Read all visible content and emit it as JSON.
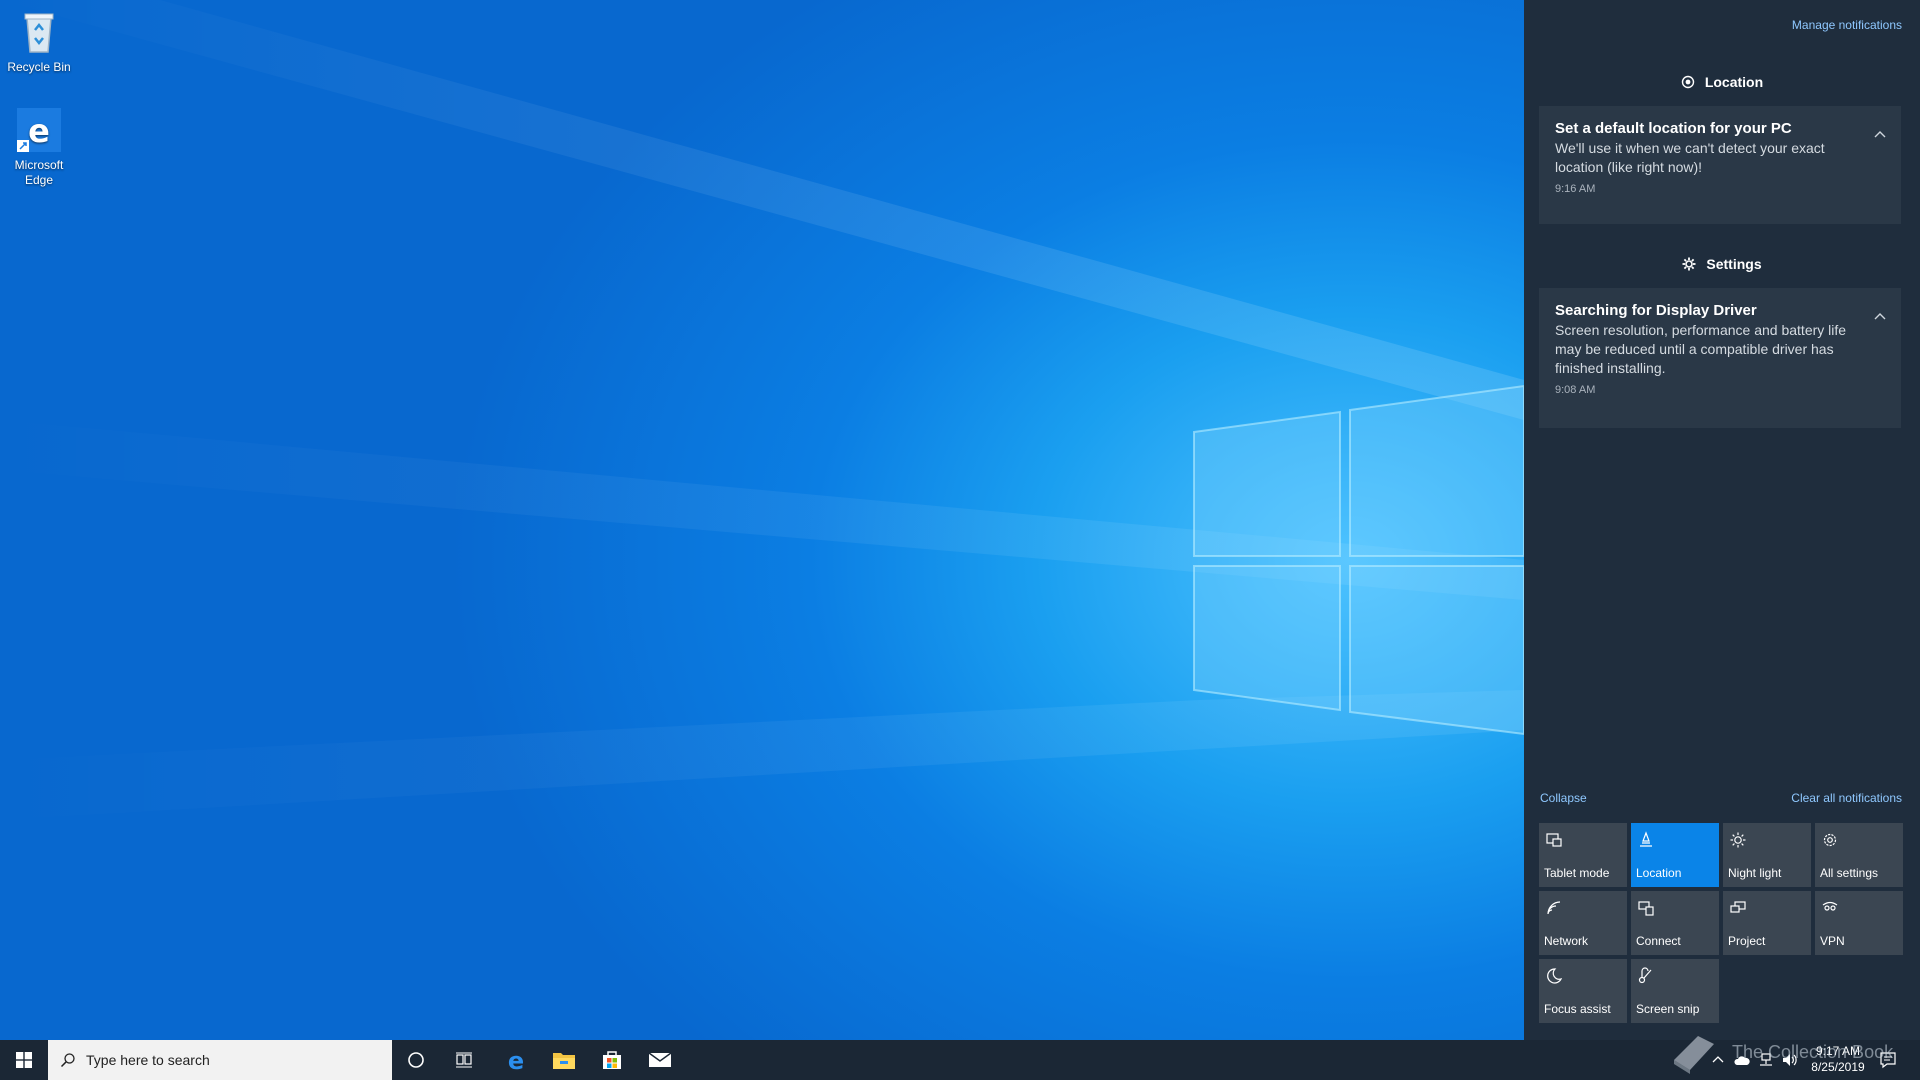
{
  "desktop": {
    "icons": [
      {
        "label": "Recycle Bin",
        "icon": "recycle-bin-icon"
      },
      {
        "label": "Microsoft Edge",
        "icon": "edge-icon"
      }
    ]
  },
  "action_center": {
    "manage_label": "Manage notifications",
    "groups": [
      {
        "app": "Location",
        "icon": "location-icon",
        "notification": {
          "title": "Set a default location for your PC",
          "body": "We'll use it when we can't detect your exact location (like right now)!",
          "time": "9:16 AM"
        }
      },
      {
        "app": "Settings",
        "icon": "gear-icon",
        "notification": {
          "title": "Searching for Display Driver",
          "body": "Screen resolution, performance and battery life may be reduced until a compatible driver has finished installing.",
          "time": "9:08 AM"
        }
      }
    ],
    "collapse_label": "Collapse",
    "clear_label": "Clear all notifications",
    "quick_actions": [
      {
        "label": "Tablet mode",
        "icon": "tablet-mode-icon",
        "active": false
      },
      {
        "label": "Location",
        "icon": "location-icon",
        "active": true
      },
      {
        "label": "Night light",
        "icon": "night-light-icon",
        "active": false
      },
      {
        "label": "All settings",
        "icon": "gear-icon",
        "active": false
      },
      {
        "label": "Network",
        "icon": "network-icon",
        "active": false
      },
      {
        "label": "Connect",
        "icon": "connect-icon",
        "active": false
      },
      {
        "label": "Project",
        "icon": "project-icon",
        "active": false
      },
      {
        "label": "VPN",
        "icon": "vpn-icon",
        "active": false
      },
      {
        "label": "Focus assist",
        "icon": "moon-icon",
        "active": false
      },
      {
        "label": "Screen snip",
        "icon": "screen-snip-icon",
        "active": false
      }
    ]
  },
  "taskbar": {
    "search_placeholder": "Type here to search",
    "apps": [
      "cortana-icon",
      "task-view-icon",
      "edge-icon",
      "file-explorer-icon",
      "store-icon",
      "mail-icon"
    ],
    "clock": {
      "time": "9:17 AM",
      "date": "8/25/2019"
    }
  },
  "watermark": {
    "text": "The Collection Book"
  },
  "colors": {
    "accent": "#0a84e8",
    "action_center_bg": "#1f2d3d",
    "taskbar_bg": "#1b2735",
    "tile_bg": "#3b4652"
  }
}
